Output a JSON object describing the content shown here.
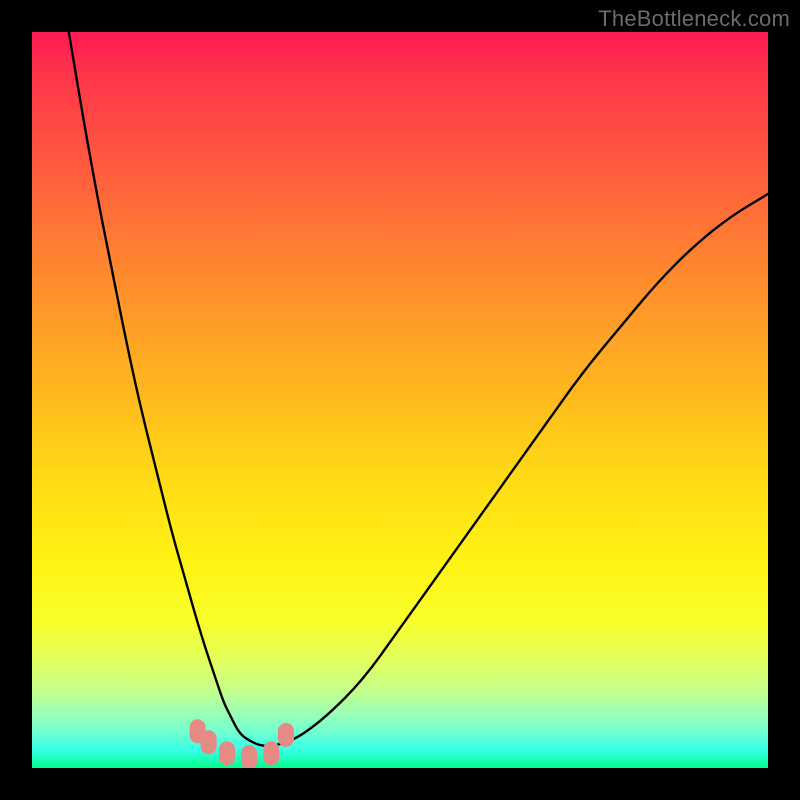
{
  "watermark": {
    "text": "TheBottleneck.com"
  },
  "chart_data": {
    "type": "line",
    "title": "",
    "xlabel": "",
    "ylabel": "",
    "xlim": [
      0,
      100
    ],
    "ylim": [
      0,
      100
    ],
    "series": [
      {
        "name": "curve",
        "x": [
          5,
          7,
          9,
          11,
          13,
          15,
          17,
          19,
          21,
          23,
          25,
          26,
          27,
          28,
          29,
          31,
          33,
          36,
          40,
          45,
          50,
          55,
          60,
          65,
          70,
          75,
          80,
          85,
          90,
          95,
          100
        ],
        "values": [
          100,
          88,
          77,
          67,
          57,
          48,
          40,
          32,
          25,
          18,
          12,
          9,
          7,
          5,
          4,
          3,
          3,
          4,
          7,
          12,
          19,
          26,
          33,
          40,
          47,
          54,
          60,
          66,
          71,
          75,
          78
        ]
      }
    ],
    "markers": [
      {
        "x": 22.5,
        "y": 5.0
      },
      {
        "x": 24.0,
        "y": 3.5
      },
      {
        "x": 26.5,
        "y": 2.0
      },
      {
        "x": 29.5,
        "y": 1.5
      },
      {
        "x": 32.5,
        "y": 2.0
      },
      {
        "x": 34.5,
        "y": 4.5
      }
    ],
    "marker_color": "#e58a85",
    "curve_color": "#000000"
  }
}
